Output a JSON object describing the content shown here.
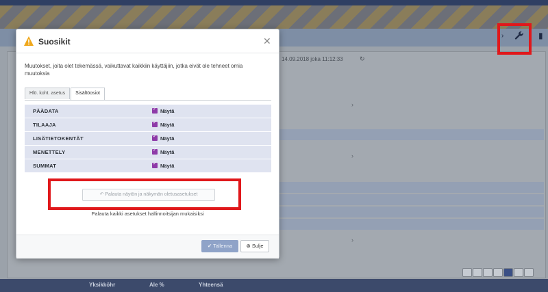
{
  "modal": {
    "title": "Suosikit",
    "intro": "Muutokset, joita olet tekemässä, vaikuttavat kaikkiin käyttäjiin, jotka eivät ole tehneet omia muutoksia",
    "tabs": [
      {
        "label": "Hlö. koht. asetus"
      },
      {
        "label": "Sisältöosiot"
      }
    ],
    "settings": [
      {
        "label": "PÄÄDATA",
        "value": "Näytä"
      },
      {
        "label": "TILAAJA",
        "value": "Näytä"
      },
      {
        "label": "LISÄTIETOKENTÄT",
        "value": "Näytä"
      },
      {
        "label": "MENETTELY",
        "value": "Näytä"
      },
      {
        "label": "SUMMAT",
        "value": "Näytä"
      }
    ],
    "reset_label": "↶ Palauta näytön ja näkymän oletusasetukset",
    "reset_description": "Palauta kaikki asetukset hallinnoitsijan mukaisiksi",
    "save_label": "✔ Tallenna",
    "close_label": "⊗ Sulje"
  },
  "background": {
    "timestamp": "14.09.2018 joka 11:12:33",
    "footer_labels": [
      "Yksikköhr",
      "Ale %",
      "Yhteensä"
    ]
  },
  "icons": {
    "warning": "warning-icon",
    "close": "close-icon",
    "wrench": "wrench-icon"
  },
  "colors": {
    "highlight": "#e0181b",
    "checkbox": "#8e3aa8",
    "save": "#8fa3c8"
  }
}
